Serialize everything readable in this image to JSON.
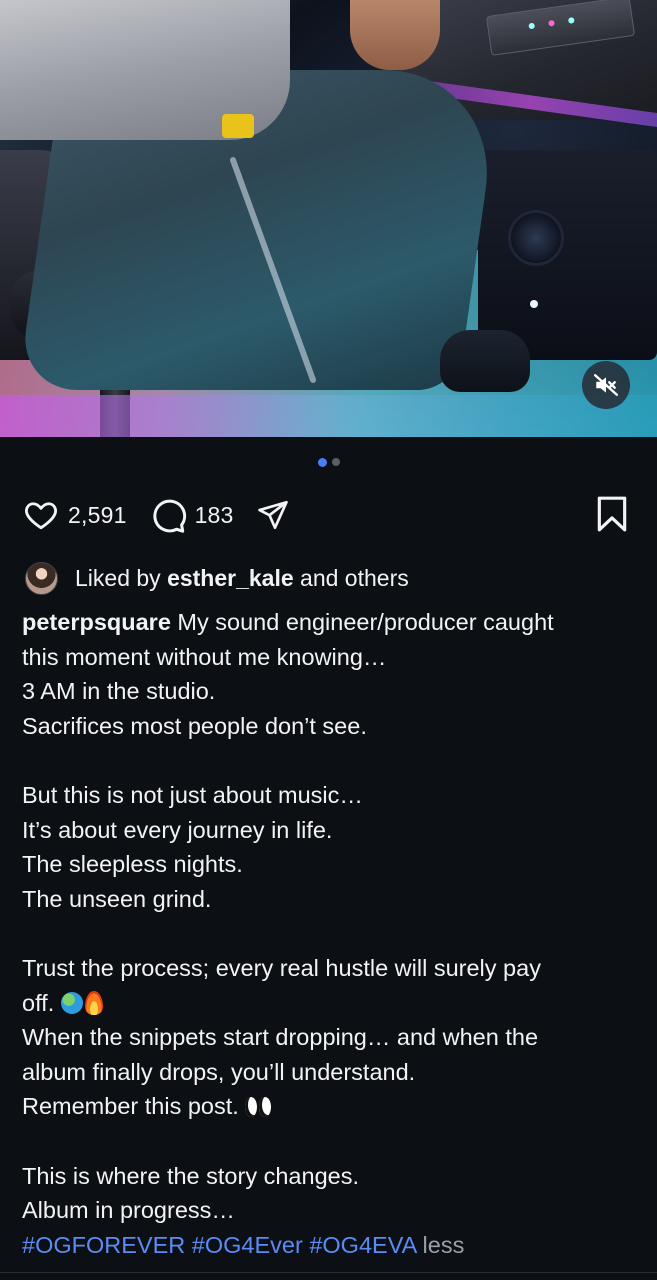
{
  "media": {
    "mute_icon": "speaker-muted-icon",
    "carousel": {
      "count": 2,
      "active_index": 0
    }
  },
  "actions": {
    "likes": "2,591",
    "comments": "183",
    "icons": [
      "heart-icon",
      "comment-icon",
      "share-icon",
      "bookmark-icon"
    ]
  },
  "liked_by": {
    "prefix": "Liked by",
    "user": "esther_kale",
    "suffix": "and others"
  },
  "caption": {
    "username": "peterpsquare",
    "first_line": "My sound engineer/producer caught",
    "lines": [
      "this moment without me knowing…",
      "3 AM in the studio.",
      "Sacrifices most people don’t see.",
      "",
      "But this is not just about music…",
      "It’s about every journey in life.",
      "The sleepless nights.",
      "The unseen grind.",
      "",
      "Trust the process; every real hustle will surely pay",
      "off.",
      "When the snippets start dropping… and when the",
      "album finally drops, you’ll understand.",
      "Remember this post.",
      "",
      "This is where the story changes.",
      "Album in progress…"
    ],
    "hashtags": [
      "#OGFOREVER",
      "#OG4Ever",
      "#OG4EVA"
    ],
    "less_label": "less"
  },
  "colors": {
    "background": "#0c0f14",
    "text": "#f2f3f5",
    "hashtag": "#5b8cf6",
    "muted": "#9aa0aa",
    "dot_active": "#4d7cf5"
  }
}
